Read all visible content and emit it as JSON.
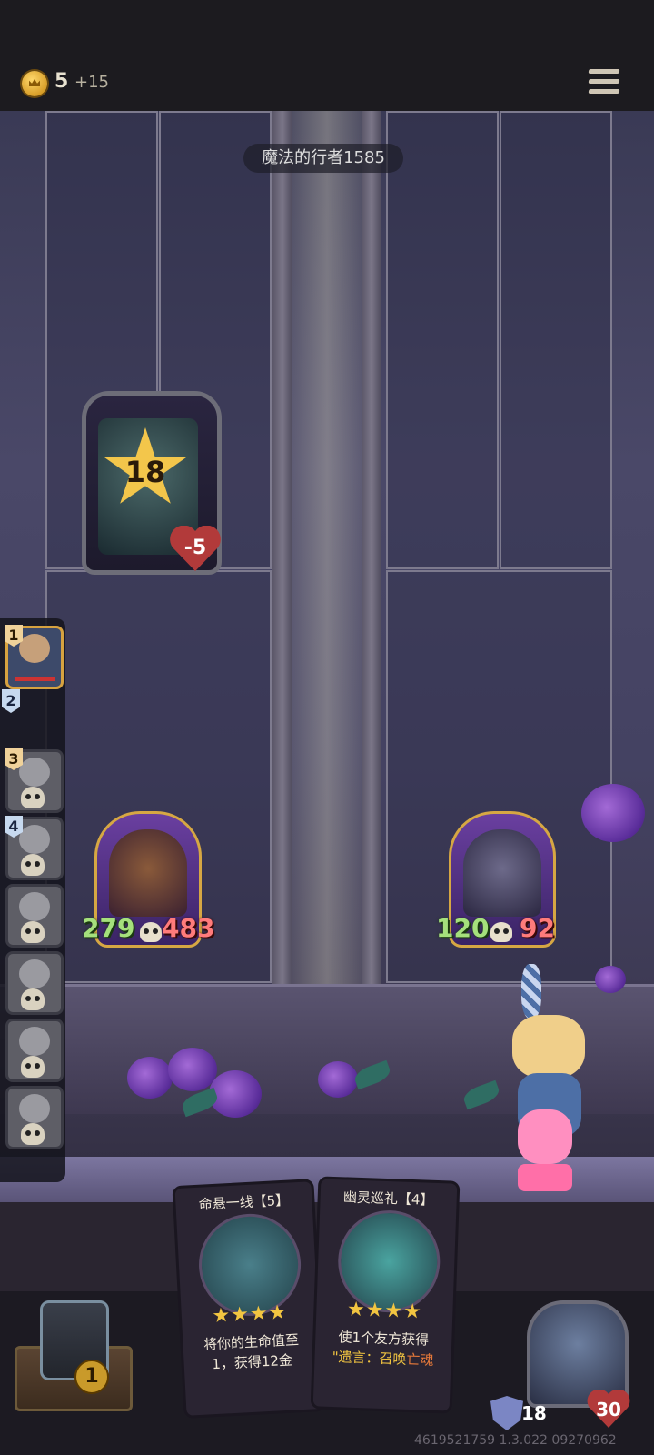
{
  "top_bar": {
    "gold": "5",
    "gold_income": "+15",
    "menu_icon": "hamburger-menu-icon"
  },
  "opponent": {
    "name": "魔法的行者1585",
    "boss_level": "18",
    "boss_health": "-5"
  },
  "sidebar": {
    "slots": [
      {
        "number": "1",
        "state": "active"
      },
      {
        "number": "2",
        "state": "current"
      },
      {
        "number": "3",
        "state": "dead"
      },
      {
        "number": "4",
        "state": "dead"
      },
      {
        "number": "",
        "state": "dead"
      },
      {
        "number": "",
        "state": "dead"
      },
      {
        "number": "",
        "state": "dead"
      },
      {
        "number": "",
        "state": "dead"
      }
    ]
  },
  "board": {
    "player_unit": {
      "attack": "279",
      "health": "483"
    },
    "enemy_unit": {
      "attack": "120",
      "health": "92"
    }
  },
  "hand": {
    "cards": [
      {
        "title": "命悬一线【5】",
        "stars": "★★★★",
        "desc_line1": "将你的生命值至",
        "desc_line2": "1，获得12金"
      },
      {
        "title": "幽灵巡礼【4】",
        "stars": "★★★★",
        "desc_line1": "使1个友方获得",
        "desc_line2_prefix": "\"遗言：召唤",
        "desc_line2_highlight": "亡魂"
      }
    ]
  },
  "deck": {
    "count": "1"
  },
  "hero": {
    "armor": "18",
    "health": "30"
  },
  "footer": {
    "version": "4619521759 1.3.022 09270962"
  },
  "colors": {
    "gold": "#f2c541",
    "attack": "#a5e07c",
    "health": "#ff7b7b",
    "frame": "#d6a743"
  }
}
